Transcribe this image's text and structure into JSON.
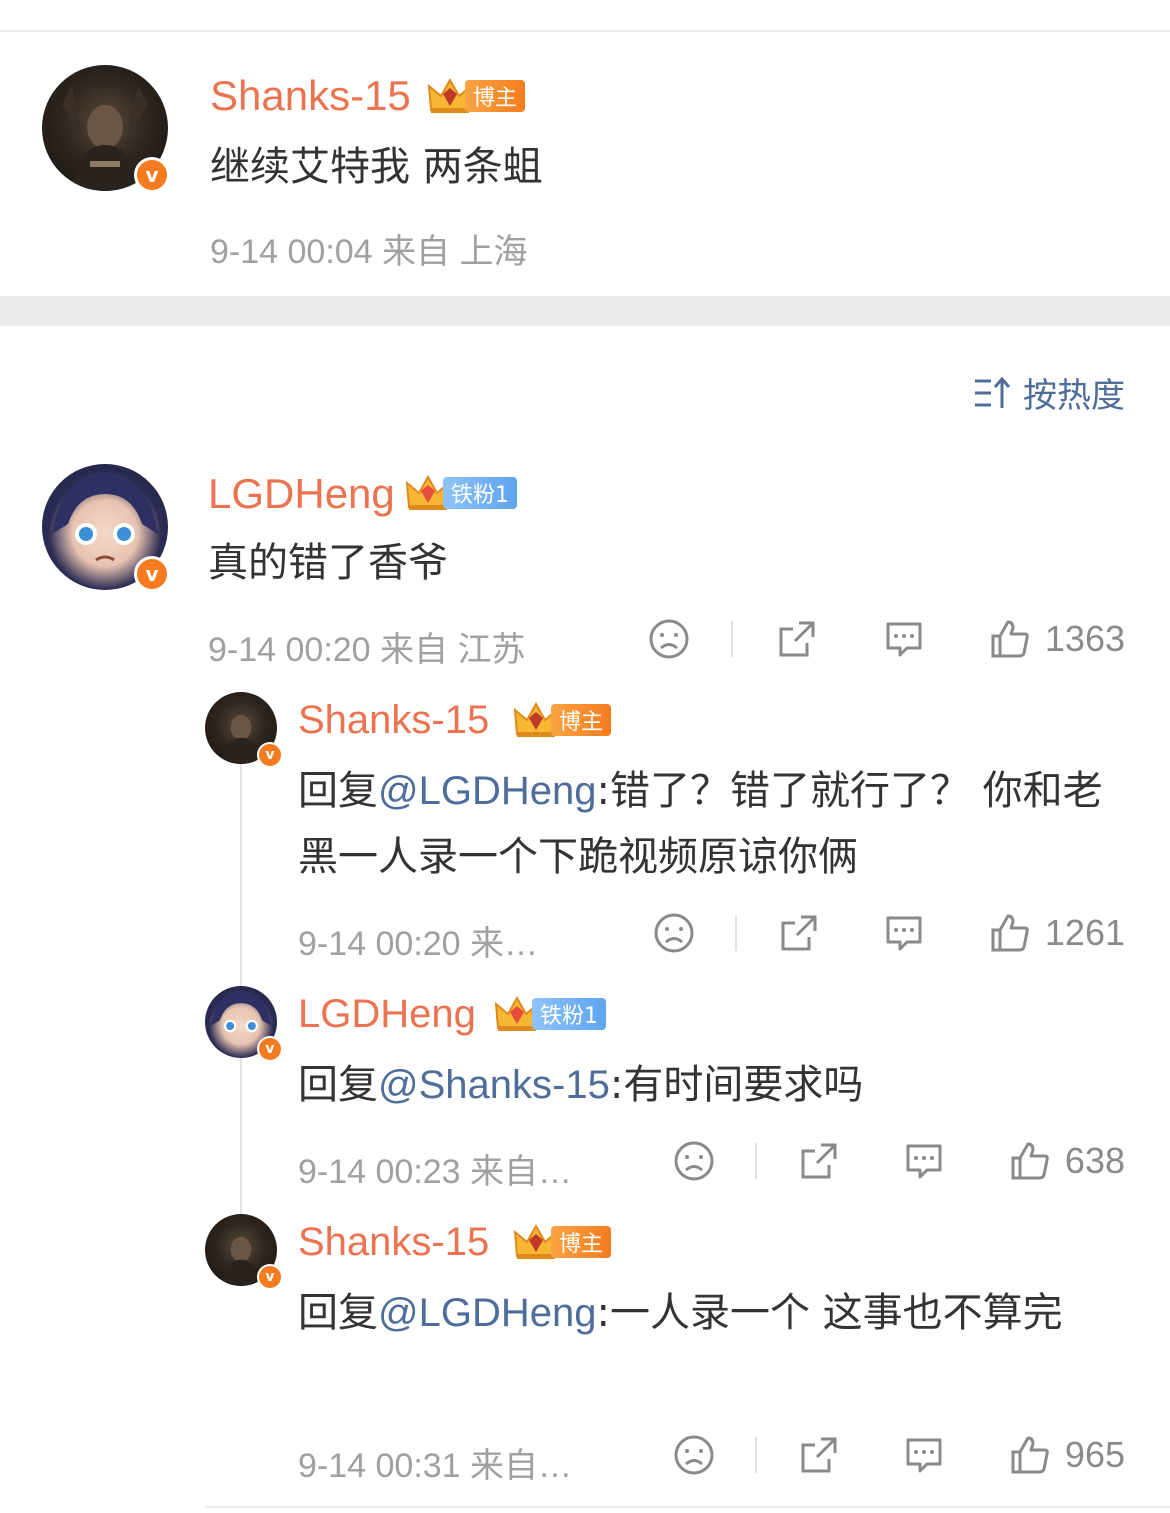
{
  "post": {
    "author": "Shanks-15",
    "badge": "博主",
    "text": "继续艾特我 两条蛆",
    "meta": "9-14 00:04 来自 上海"
  },
  "sort": {
    "label": "按热度",
    "icon": "sort-icon"
  },
  "comments": [
    {
      "author": "LGDHeng",
      "badge": "铁粉1",
      "text": "真的错了香爷",
      "meta": "9-14 00:20 来自 江苏",
      "likes": "1363"
    }
  ],
  "replies": [
    {
      "author": "Shanks-15",
      "badge": "博主",
      "prefix": "回复",
      "mention": "@LGDHeng",
      "text": ":错了？错了就行了？ 你和老黑一人录一个下跪视频原谅你俩",
      "meta": "9-14 00:20 来…",
      "likes": "1261"
    },
    {
      "author": "LGDHeng",
      "badge": "铁粉1",
      "prefix": "回复",
      "mention": "@Shanks-15",
      "text": ":有时间要求吗",
      "meta": "9-14 00:23 来自…",
      "likes": "638"
    },
    {
      "author": "Shanks-15",
      "badge": "博主",
      "prefix": "回复",
      "mention": "@LGDHeng",
      "text": ":一人录一个 这事也不算完",
      "meta": "9-14 00:31 来自…",
      "likes": "965"
    }
  ],
  "colors": {
    "name": "#eb7350",
    "mention": "#4f6d9b",
    "meta": "#a0a0a0",
    "verified": "#f47b20"
  },
  "verified_mark": "v"
}
